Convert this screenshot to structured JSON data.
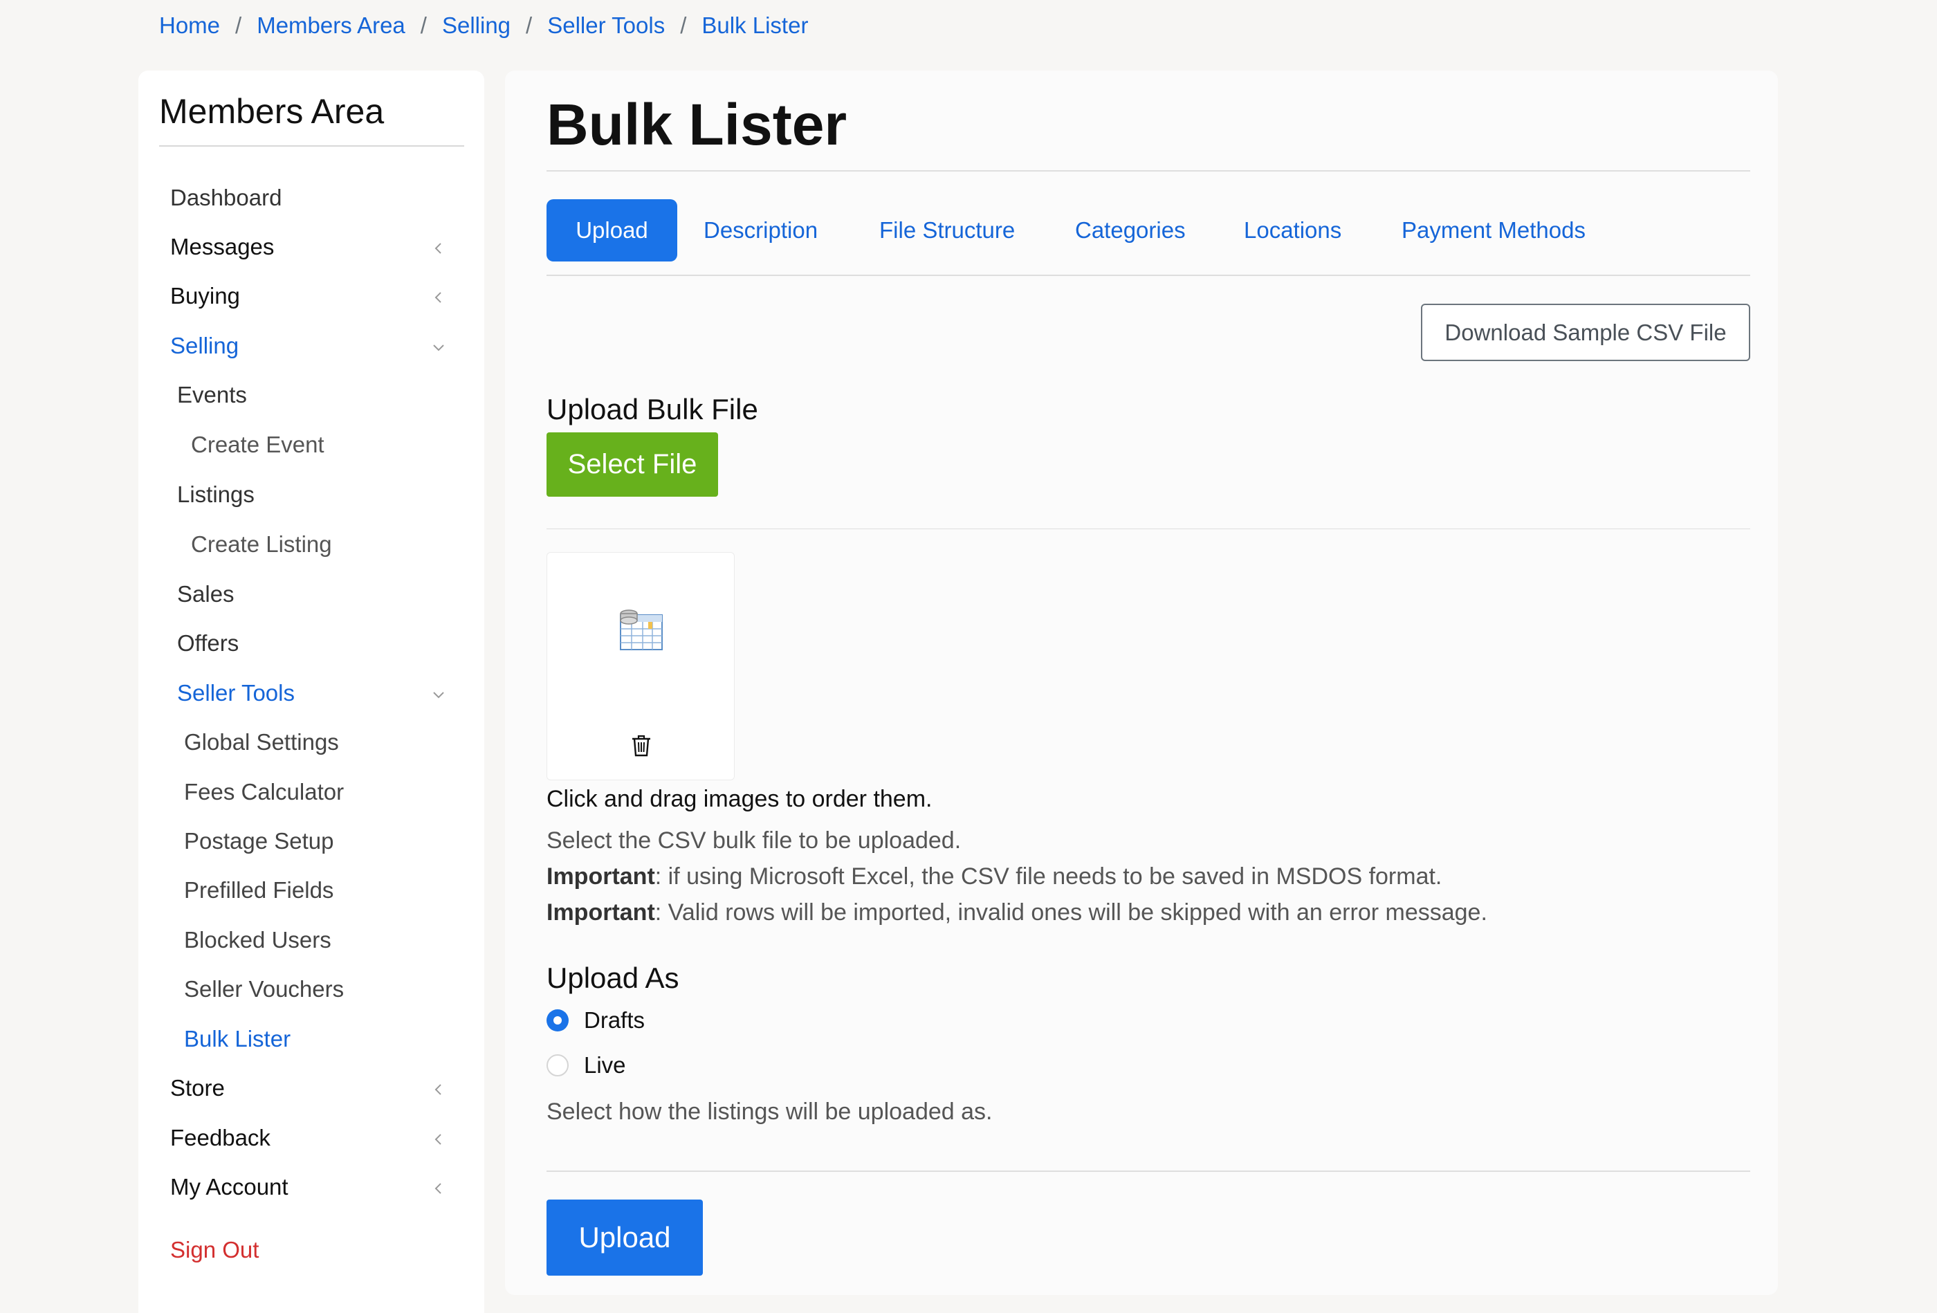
{
  "breadcrumb": {
    "items": [
      "Home",
      "Members Area",
      "Selling",
      "Seller Tools",
      "Bulk Lister"
    ],
    "separator": "/"
  },
  "sidebar": {
    "title": "Members Area",
    "items": {
      "dashboard": "Dashboard",
      "messages": "Messages",
      "buying": "Buying",
      "selling": "Selling",
      "events": "Events",
      "create_event": "Create Event",
      "listings": "Listings",
      "create_listing": "Create Listing",
      "sales": "Sales",
      "offers": "Offers",
      "seller_tools": "Seller Tools",
      "global_settings": "Global Settings",
      "fees_calculator": "Fees Calculator",
      "postage_setup": "Postage Setup",
      "prefilled_fields": "Prefilled Fields",
      "blocked_users": "Blocked Users",
      "seller_vouchers": "Seller Vouchers",
      "bulk_lister": "Bulk Lister",
      "store": "Store",
      "feedback": "Feedback",
      "my_account": "My Account",
      "sign_out": "Sign Out"
    },
    "icons": {
      "collapsed": "chevron-left-icon",
      "expanded": "chevron-down-icon"
    }
  },
  "main": {
    "title": "Bulk Lister",
    "tabs": [
      "Upload",
      "Description",
      "File Structure",
      "Categories",
      "Locations",
      "Payment Methods"
    ],
    "active_tab": "Upload",
    "download_button": "Download Sample CSV File",
    "upload_bulk_file_label": "Upload Bulk File",
    "select_file_button": "Select File",
    "file_card": {
      "file_icon": "spreadsheet-file-icon",
      "delete_icon": "trash-icon"
    },
    "drag_hint": "Click and drag images to order them.",
    "help_text": "Select the CSV bulk file to be uploaded.",
    "important_label": "Important",
    "important_1": ": if using Microsoft Excel, the CSV file needs to be saved in MSDOS format.",
    "important_2": ": Valid rows will be imported, invalid ones will be skipped with an error message.",
    "upload_as_label": "Upload As",
    "radio_options": [
      "Drafts",
      "Live"
    ],
    "radio_selected": "Drafts",
    "upload_as_help": "Select how the listings will be uploaded as.",
    "submit_button": "Upload"
  },
  "colors": {
    "accent": "#1a73e8",
    "link": "#1565d8",
    "success": "#67b11c",
    "danger": "#d32f2f",
    "background": "#f7f6f4"
  }
}
